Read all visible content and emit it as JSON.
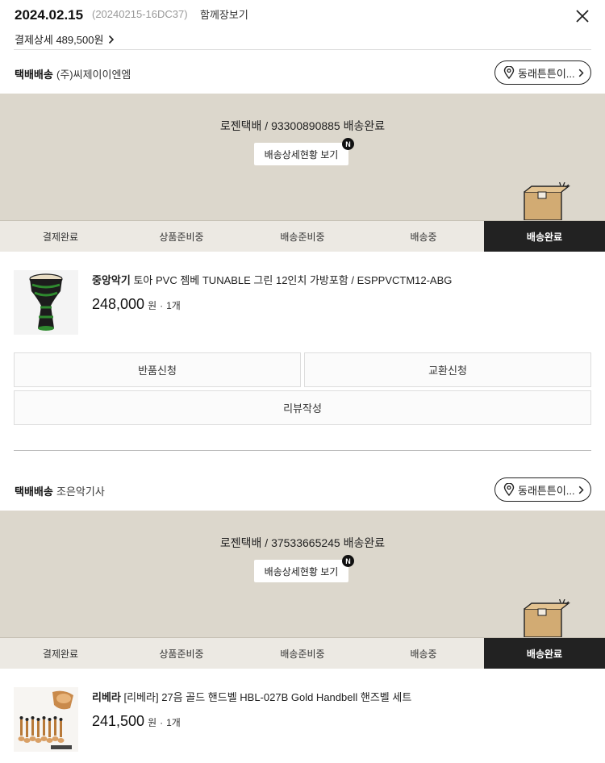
{
  "header": {
    "date": "2024.02.15",
    "order_no": "(20240215-16DC37)",
    "together": "함께장보기",
    "pay_detail": "결제상세 489,500원"
  },
  "orders": [
    {
      "ship_type": "택배배송",
      "ship_company": "(주)씨제이이엔엠",
      "address_button": "동래튼튼이...",
      "tracking": "로젠택배 / 93300890885 배송완료",
      "track_button": "배송상세현황 보기",
      "badge": "N",
      "steps": [
        "결제완료",
        "상품준비중",
        "배송준비중",
        "배송중",
        "배송완료"
      ],
      "active_step": 4,
      "product": {
        "brand": "중앙악기",
        "name": " 토아 PVC 젬베 TUNABLE 그린 12인치 가방포함 / ESPPVCTM12-ABG",
        "price": "248,000",
        "won": "원",
        "qty": "1개"
      },
      "actions": {
        "return": "반품신청",
        "exchange": "교환신청",
        "review": "리뷰작성"
      }
    },
    {
      "ship_type": "택배배송",
      "ship_company": "조은악기사",
      "address_button": "동래튼튼이...",
      "tracking": "로젠택배 / 37533665245 배송완료",
      "track_button": "배송상세현황 보기",
      "badge": "N",
      "steps": [
        "결제완료",
        "상품준비중",
        "배송준비중",
        "배송중",
        "배송완료"
      ],
      "active_step": 4,
      "product": {
        "brand": "리베라",
        "name": " [리베라] 27음 골드 핸드벨 HBL-027B Gold Handbell 핸즈벨 세트",
        "price": "241,500",
        "won": "원",
        "qty": "1개"
      }
    }
  ],
  "icons": {
    "close": "close-icon",
    "chevron": "chevron-right-icon",
    "location": "location-pin-icon",
    "box": "delivered-box-icon"
  }
}
